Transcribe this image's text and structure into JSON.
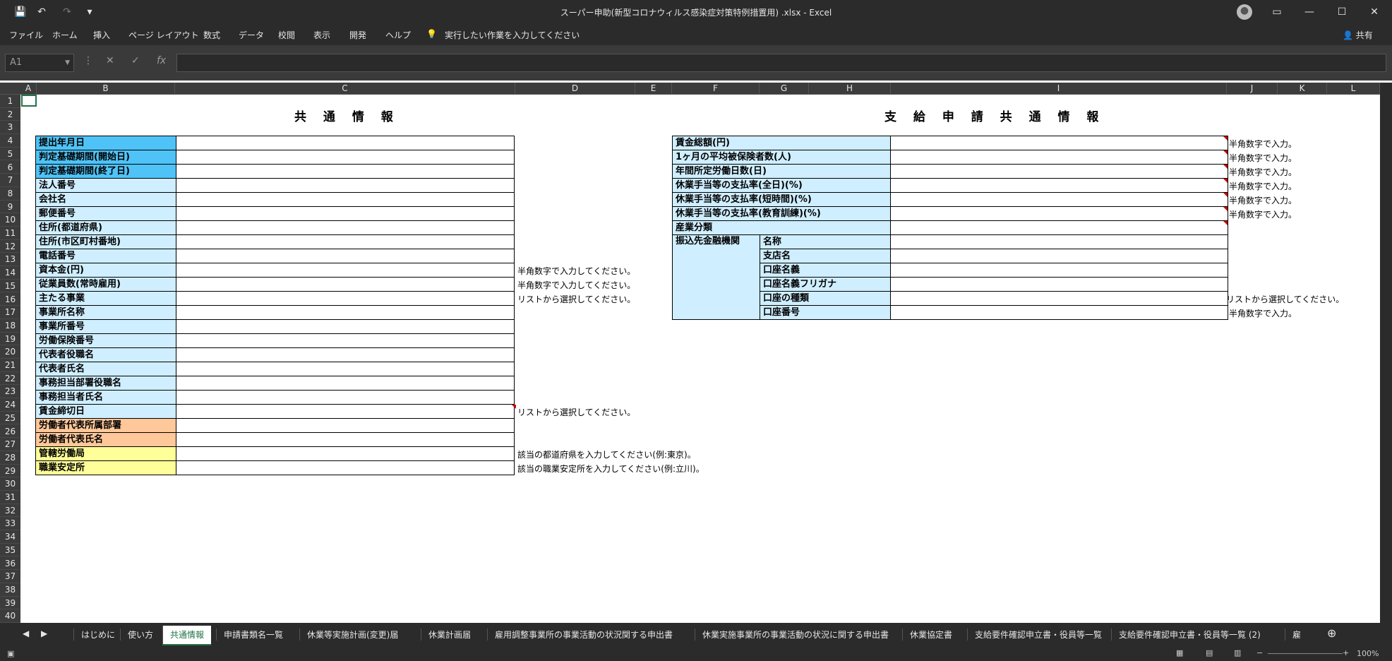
{
  "window": {
    "title": "スーパー申助(新型コロナウィルス感染症対策特例措置用) .xlsx - Excel",
    "share": "共有"
  },
  "menu": [
    "ファイル",
    "ホーム",
    "挿入",
    "ページ レイアウト",
    "数式",
    "データ",
    "校閲",
    "表示",
    "開発",
    "ヘルプ"
  ],
  "tell_me": "実行したい作業を入力してください",
  "name_box": "A1",
  "columns": [
    "A",
    "B",
    "C",
    "D",
    "E",
    "F",
    "G",
    "H",
    "I",
    "J",
    "K",
    "L"
  ],
  "rows": [
    "1",
    "2",
    "3",
    "4",
    "5",
    "6",
    "7",
    "8",
    "9",
    "10",
    "11",
    "12",
    "13",
    "14",
    "15",
    "16",
    "17",
    "18",
    "19",
    "20",
    "21",
    "22",
    "23",
    "24",
    "25",
    "26",
    "27",
    "28",
    "29",
    "30",
    "31",
    "32",
    "33",
    "34",
    "35",
    "36",
    "37",
    "38",
    "39",
    "40"
  ],
  "left": {
    "heading": "共 通 情 報",
    "fields": [
      {
        "label": "提出年月日",
        "color": "blue"
      },
      {
        "label": "判定基礎期間(開始日)",
        "color": "blue"
      },
      {
        "label": "判定基礎期間(終了日)",
        "color": "blue"
      },
      {
        "label": "法人番号",
        "color": "lblue"
      },
      {
        "label": "会社名",
        "color": "lblue"
      },
      {
        "label": "郵便番号",
        "color": "lblue"
      },
      {
        "label": "住所(都道府県)",
        "color": "lblue"
      },
      {
        "label": "住所(市区町村番地)",
        "color": "lblue"
      },
      {
        "label": "電話番号",
        "color": "lblue"
      },
      {
        "label": "資本金(円)",
        "color": "lblue",
        "note": "半角数字で入力してください。"
      },
      {
        "label": "従業員数(常時雇用)",
        "color": "lblue",
        "note": "半角数字で入力してください。"
      },
      {
        "label": "主たる事業",
        "color": "lblue",
        "note": "リストから選択してください。"
      },
      {
        "label": "事業所名称",
        "color": "lblue"
      },
      {
        "label": "事業所番号",
        "color": "lblue"
      },
      {
        "label": "労働保険番号",
        "color": "lblue"
      },
      {
        "label": "代表者役職名",
        "color": "lblue"
      },
      {
        "label": "代表者氏名",
        "color": "lblue"
      },
      {
        "label": "事務担当部署役職名",
        "color": "lblue"
      },
      {
        "label": "事務担当者氏名",
        "color": "lblue"
      },
      {
        "label": "賃金締切日",
        "color": "lblue",
        "note": "リストから選択してください。"
      },
      {
        "label": "労働者代表所属部署",
        "color": "orange"
      },
      {
        "label": "労働者代表氏名",
        "color": "orange"
      },
      {
        "label": "管轄労働局",
        "color": "yellow",
        "note": "該当の都道府県を入力してください(例:東京)。"
      },
      {
        "label": "職業安定所",
        "color": "yellow",
        "note": "該当の職業安定所を入力してください(例:立川)。"
      }
    ]
  },
  "right": {
    "heading": "支 給 申 請 共 通 情 報",
    "fields": [
      {
        "label": "賃金総額(円)",
        "note": "半角数字で入力。"
      },
      {
        "label": "1ヶ月の平均被保険者数(人)",
        "note": "半角数字で入力。"
      },
      {
        "label": "年間所定労働日数(日)",
        "note": "半角数字で入力。"
      },
      {
        "label": "休業手当等の支払率(全日)(%)",
        "note": "半角数字で入力。"
      },
      {
        "label": "休業手当等の支払率(短時間)(%)",
        "note": "半角数字で入力。"
      },
      {
        "label": "休業手当等の支払率(教育訓練)(%)",
        "note": "半角数字で入力。"
      },
      {
        "label": "産業分類"
      }
    ],
    "bank_label": "振込先金融機関",
    "bank_fields": [
      {
        "label": "名称"
      },
      {
        "label": "支店名"
      },
      {
        "label": "口座名義"
      },
      {
        "label": "口座名義フリガナ"
      },
      {
        "label": "口座の種類",
        "note": "リストから選択してください。"
      },
      {
        "label": "口座番号",
        "note": "半角数字で入力。"
      }
    ]
  },
  "tabs": [
    "はじめに",
    "使い方",
    "共通情報",
    "申請書類名一覧",
    "休業等実施計画(変更)届",
    "休業計画届",
    "雇用調整事業所の事業活動の状況関する申出書",
    "休業実施事業所の事業活動の状況に関する申出書",
    "休業協定書",
    "支給要件確認申立書・役員等一覧",
    "支給要件確認申立書・役員等一覧 (2)",
    "雇"
  ],
  "active_tab": "共通情報",
  "zoom": "100%"
}
